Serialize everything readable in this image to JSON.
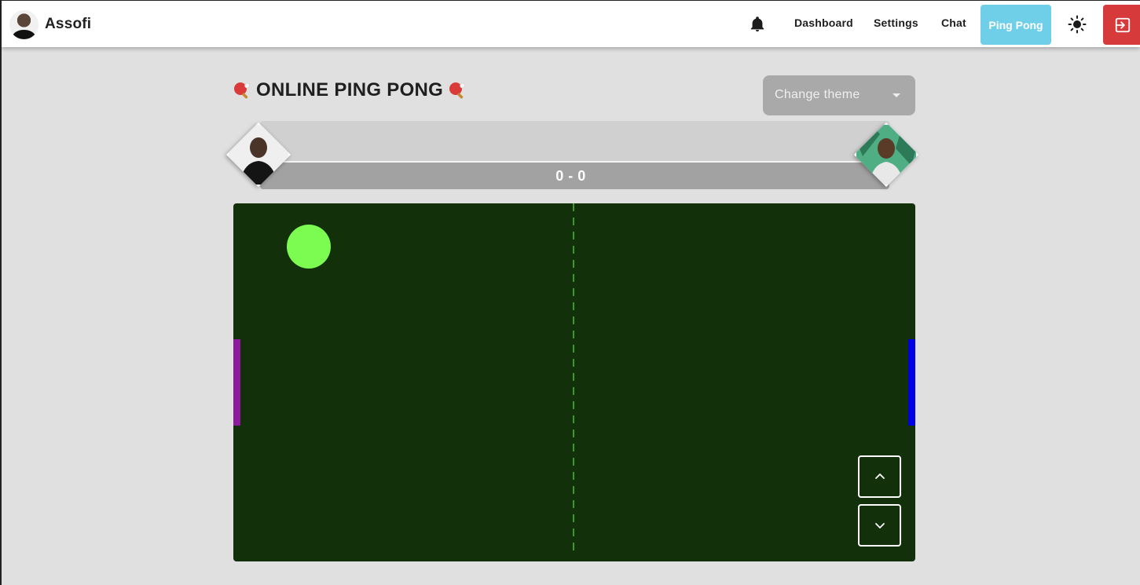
{
  "user": {
    "name": "Assofi"
  },
  "nav": {
    "links": [
      "Dashboard",
      "Settings",
      "Chat"
    ],
    "active": "Ping Pong"
  },
  "icons": {
    "notifications": "bell-icon",
    "theme_toggle": "sun-icon",
    "logout": "logout-icon",
    "title_decoration": "ping-pong-paddle-icon",
    "paddle_up": "chevron-up-icon",
    "paddle_down": "chevron-down-icon"
  },
  "page": {
    "title": "ONLINE PING PONG",
    "theme_select": {
      "placeholder": "Change theme"
    }
  },
  "match": {
    "score": "0 - 0",
    "score_left": 0,
    "score_right": 0
  },
  "colors": {
    "accent_active": "#6fcfe8",
    "logout": "#d63a3a",
    "board": "#12300a",
    "ball": "#7cfc50",
    "net": "#3a9a2a",
    "paddle_left": "#8b1a9c",
    "paddle_right": "#0000e6"
  }
}
